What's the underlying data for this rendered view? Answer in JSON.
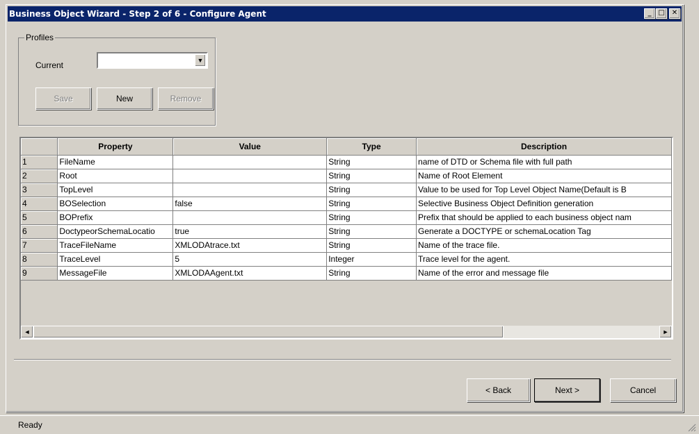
{
  "window": {
    "title": "Business Object Wizard - Step 2 of 6 - Configure Agent"
  },
  "profiles": {
    "legend": "Profiles",
    "current_label": "Current",
    "current_value": "",
    "save_label": "Save",
    "new_label": "New",
    "remove_label": "Remove"
  },
  "table": {
    "headers": [
      "Property",
      "Value",
      "Type",
      "Description"
    ],
    "rows": [
      {
        "num": "1",
        "property": "FileName",
        "value": "",
        "type": "String",
        "description": "name of DTD or Schema file with full path"
      },
      {
        "num": "2",
        "property": "Root",
        "value": "",
        "type": "String",
        "description": "Name of Root Element"
      },
      {
        "num": "3",
        "property": "TopLevel",
        "value": "",
        "type": "String",
        "description": "Value to be used for Top Level Object Name(Default is B"
      },
      {
        "num": "4",
        "property": "BOSelection",
        "value": "false",
        "type": "String",
        "description": "Selective Business Object Definition generation"
      },
      {
        "num": "5",
        "property": "BOPrefix",
        "value": "",
        "type": "String",
        "description": "Prefix that should be applied to each business object nam"
      },
      {
        "num": "6",
        "property": "DoctypeorSchemaLocatio",
        "value": "true",
        "type": "String",
        "description": "Generate a DOCTYPE or schemaLocation Tag"
      },
      {
        "num": "7",
        "property": "TraceFileName",
        "value": "XMLODAtrace.txt",
        "type": "String",
        "description": "Name of the trace file."
      },
      {
        "num": "8",
        "property": "TraceLevel",
        "value": "5",
        "type": "Integer",
        "description": "Trace level for the agent."
      },
      {
        "num": "9",
        "property": "MessageFile",
        "value": "XMLODAAgent.txt",
        "type": "String",
        "description": "Name of the error and message file"
      }
    ]
  },
  "nav": {
    "back_label": "< Back",
    "next_label": "Next >",
    "cancel_label": "Cancel"
  },
  "status": {
    "text": "Ready"
  },
  "icons": {
    "scroll_left": "◄",
    "scroll_right": "►",
    "dropdown": "▼"
  },
  "titlebar_buttons": {
    "minimize": "_",
    "maximize": "□",
    "close": "✕"
  }
}
